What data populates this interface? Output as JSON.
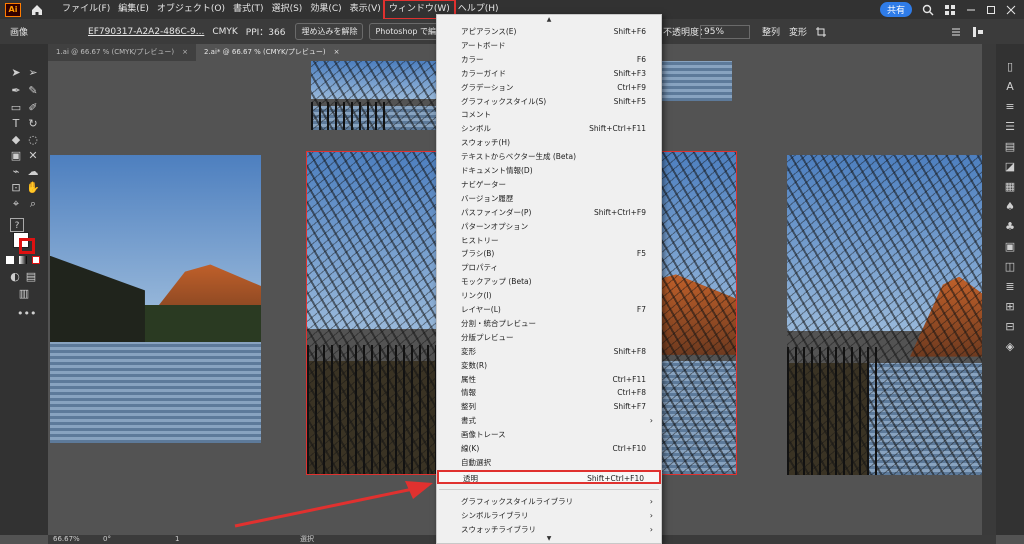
{
  "menubar": {
    "logo": "Ai",
    "menus": [
      "ファイル(F)",
      "編集(E)",
      "オブジェクト(O)",
      "書式(T)",
      "選択(S)",
      "効果(C)",
      "表示(V)",
      "ウィンドウ(W)",
      "ヘルプ(H)"
    ],
    "share": "共有"
  },
  "ctrlbar": {
    "image_label": "画像",
    "file_link": "EF790317-A2A2-486C-9...",
    "color_mode": "CMYK",
    "ppi": "PPI：366",
    "embed_button": "埋め込みを解除",
    "photoshop_button": "Photoshop で編集",
    "opacity_label": "不透明度：",
    "opacity_value": "95%",
    "align": "整列",
    "transform": "変形"
  },
  "tabs": [
    {
      "label": "1.ai @ 66.67 % (CMYK/プレビュー)",
      "active": false
    },
    {
      "label": "2.ai* @ 66.67 % (CMYK/プレビュー)",
      "active": true
    }
  ],
  "window_menu": {
    "items": [
      {
        "label": "アピアランス(E)",
        "shortcut": "Shift+F6"
      },
      {
        "label": "アートボード",
        "shortcut": ""
      },
      {
        "label": "カラー",
        "shortcut": "F6"
      },
      {
        "label": "カラーガイド",
        "shortcut": "Shift+F3"
      },
      {
        "label": "グラデーション",
        "shortcut": "Ctrl+F9"
      },
      {
        "label": "グラフィックスタイル(S)",
        "shortcut": "Shift+F5"
      },
      {
        "label": "コメント",
        "shortcut": ""
      },
      {
        "label": "シンボル",
        "shortcut": "Shift+Ctrl+F11"
      },
      {
        "label": "スウォッチ(H)",
        "shortcut": ""
      },
      {
        "label": "テキストからベクター生成 (Beta)",
        "shortcut": ""
      },
      {
        "label": "ドキュメント情報(D)",
        "shortcut": ""
      },
      {
        "label": "ナビゲーター",
        "shortcut": ""
      },
      {
        "label": "バージョン履歴",
        "shortcut": ""
      },
      {
        "label": "パスファインダー(P)",
        "shortcut": "Shift+Ctrl+F9"
      },
      {
        "label": "パターンオプション",
        "shortcut": ""
      },
      {
        "label": "ヒストリー",
        "shortcut": ""
      },
      {
        "label": "ブラシ(B)",
        "shortcut": "F5"
      },
      {
        "label": "プロパティ",
        "shortcut": ""
      },
      {
        "label": "モックアップ (Beta)",
        "shortcut": ""
      },
      {
        "label": "リンク(I)",
        "shortcut": ""
      },
      {
        "label": "レイヤー(L)",
        "shortcut": "F7"
      },
      {
        "label": "分割・統合プレビュー",
        "shortcut": ""
      },
      {
        "label": "分版プレビュー",
        "shortcut": ""
      },
      {
        "label": "変形",
        "shortcut": "Shift+F8"
      },
      {
        "label": "変数(R)",
        "shortcut": ""
      },
      {
        "label": "属性",
        "shortcut": "Ctrl+F11"
      },
      {
        "label": "情報",
        "shortcut": "Ctrl+F8"
      },
      {
        "label": "整列",
        "shortcut": "Shift+F7"
      },
      {
        "label": "書式",
        "shortcut": "",
        "submenu": true
      },
      {
        "label": "画像トレース",
        "shortcut": ""
      },
      {
        "label": "線(K)",
        "shortcut": "Ctrl+F10"
      },
      {
        "label": "自動選択",
        "shortcut": ""
      },
      {
        "label": "透明",
        "shortcut": "Shift+Ctrl+F10",
        "highlight": true
      }
    ],
    "library_items": [
      {
        "label": "グラフィックスタイルライブラリ",
        "submenu": true
      },
      {
        "label": "シンボルライブラリ",
        "submenu": true
      },
      {
        "label": "スウォッチライブラリ",
        "submenu": true
      }
    ]
  },
  "status": {
    "zoom": "66.67%",
    "rotate": "0°",
    "artboard": "1",
    "mode": "選択"
  },
  "colors": {
    "highlight": "#e0312f",
    "accent": "#2f7ce8"
  }
}
